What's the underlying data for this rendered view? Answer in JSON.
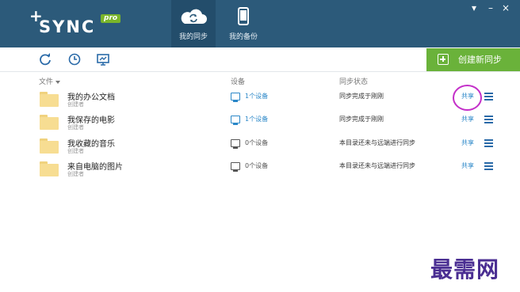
{
  "app": {
    "logo_plus": "+",
    "logo_text": "SYNC",
    "logo_badge": "pro",
    "colors": {
      "header": "#2c5a7a",
      "accent_green": "#6ab23a",
      "link_blue": "#2a87c8",
      "highlight": "#c430c9"
    }
  },
  "nav": {
    "tabs": [
      {
        "label": "我的同步",
        "icon": "cloud-sync-icon",
        "active": true
      },
      {
        "label": "我的备份",
        "icon": "phone-icon",
        "active": false
      }
    ]
  },
  "window_controls": {
    "dropdown": "▾",
    "minimize": "–",
    "close": "×"
  },
  "toolbar": {
    "icons": [
      "refresh-icon",
      "history-clock-icon",
      "monitor-icon"
    ],
    "create_label": "创建新同步"
  },
  "columns": {
    "file": "文件",
    "device": "设备",
    "status": "同步状态"
  },
  "rows": [
    {
      "name": "我的办公文档",
      "sub": "创建者",
      "device": "1个设备",
      "device_active": true,
      "status": "同步完成于刚刚",
      "share": "共享"
    },
    {
      "name": "我保存的电影",
      "sub": "创建者",
      "device": "1个设备",
      "device_active": true,
      "status": "同步完成于刚刚",
      "share": "共享"
    },
    {
      "name": "我收藏的音乐",
      "sub": "创建者",
      "device": "0个设备",
      "device_active": false,
      "status": "本目录还未与远端进行同步",
      "share": "共享"
    },
    {
      "name": "来自电脑的图片",
      "sub": "创建者",
      "device": "0个设备",
      "device_active": false,
      "status": "本目录还未与远端进行同步",
      "share": "共享"
    }
  ],
  "watermark": "最需网"
}
